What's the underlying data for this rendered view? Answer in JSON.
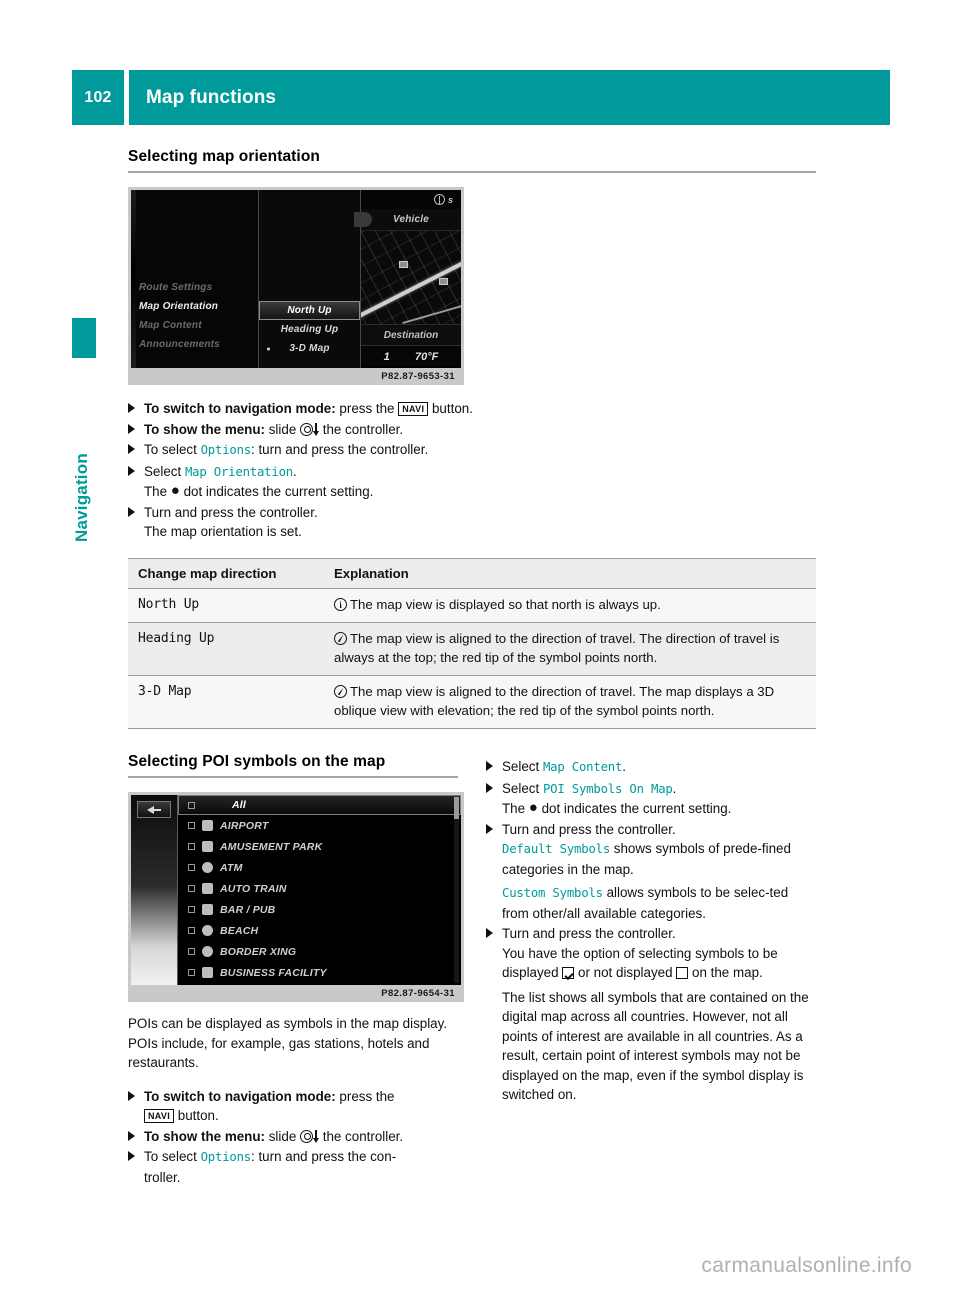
{
  "header": {
    "page_number": "102",
    "title": "Map functions"
  },
  "sidebar": {
    "tab_label": "Navigation",
    "accent_color": "#009a9a"
  },
  "section1": {
    "heading": "Selecting map orientation",
    "image": {
      "caption_code": "P82.87-9653-31",
      "menu_items": [
        "Route Settings",
        "Map Orientation",
        "Map Content",
        "Announcements"
      ],
      "active_menu_item": "Map Orientation",
      "submenu_items": [
        "North Up",
        "Heading Up",
        "3-D Map"
      ],
      "selected_submenu": "North Up",
      "dot_submenu": "3-D Map",
      "status_text": "s",
      "vehicle_label": "Vehicle",
      "destination_label": "Destination",
      "bottom_left": "1",
      "temperature": "70°F"
    },
    "steps": [
      {
        "bold": "To switch to navigation mode:",
        "text": " press the ",
        "key": "NAVI",
        "after": " button."
      },
      {
        "bold": "To show the menu:",
        "text": " slide ",
        "glyph": "controller-slide-down",
        "after": " the controller."
      },
      {
        "pre": "To select ",
        "mono": "Options",
        "after": ": turn and press the controller."
      },
      {
        "pre": "Select ",
        "mono": "Map Orientation",
        "after": ".",
        "sub": "The ● dot indicates the current setting."
      },
      {
        "pre": "Turn and press the controller.",
        "sub": "The map orientation is set."
      }
    ],
    "sub_line_1": "The ",
    "sub_line_1_tail": " dot indicates the current setting.",
    "sub_line_2": "The map orientation is set."
  },
  "table": {
    "headers": [
      "Change map direction",
      "Explanation"
    ],
    "rows": [
      {
        "option": "North Up",
        "icon": "compass-north-icon",
        "explanation": "The map view is displayed so that north is always up."
      },
      {
        "option": "Heading Up",
        "icon": "compass-heading-icon",
        "explanation": "The map view is aligned to the direction of travel. The direction of travel is always at the top; the red tip of the symbol points north."
      },
      {
        "option": "3-D Map",
        "icon": "compass-heading-icon",
        "explanation": "The map view is aligned to the direction of travel. The map displays a 3D oblique view with elevation; the red tip of the symbol points north."
      }
    ]
  },
  "section2": {
    "heading": "Selecting POI symbols on the map",
    "image": {
      "caption_code": "P82.87-9654-31",
      "header_row": "All",
      "rows": [
        "AIRPORT",
        "AMUSEMENT PARK",
        "ATM",
        "AUTO TRAIN",
        "BAR / PUB",
        "BEACH",
        "BORDER XING",
        "BUSINESS FACILITY"
      ]
    },
    "intro": "POIs can be displayed as symbols in the map display. POIs include, for example, gas stations, hotels and restaurants.",
    "left_steps": {
      "s1_bold": "To switch to navigation mode:",
      "s1_text": " press the ",
      "s1_key": "NAVI",
      "s1_after": " button.",
      "s2_bold": "To show the menu:",
      "s2_text": " slide ",
      "s2_after": " the controller.",
      "s3_pre": "To select ",
      "s3_mono": "Options",
      "s3_after": ": turn and press the con-",
      "s3_cont": "troller."
    },
    "right_steps": {
      "r1_pre": "Select ",
      "r1_mono": "Map Content",
      "r1_after": ".",
      "r2_pre": "Select ",
      "r2_mono": "POI Symbols On Map",
      "r2_after": ".",
      "r2_sub_pre": "The ",
      "r2_sub_post": " dot indicates the current setting.",
      "r3_pre": "Turn and press the controller.",
      "r3_mono_a": "Default Symbols",
      "r3_text_a": " shows symbols of prede-fined categories in the map.",
      "r3_mono_b": "Custom Symbols",
      "r3_text_b": " allows symbols to be selec-ted from other/all available categories.",
      "r4_pre": "Turn and press the controller.",
      "r4_sub_a": "You have the option of selecting symbols to be displayed ",
      "r4_sub_b": " or not displayed ",
      "r4_sub_c": " on the map.",
      "r4_para": "The list shows all symbols that are contained on the digital map across all countries. However, not all points of interest are available in all countries. As a result, certain point of interest symbols may not be displayed on the map, even if the symbol display is switched on."
    }
  },
  "watermark": "carmanualsonline.info"
}
